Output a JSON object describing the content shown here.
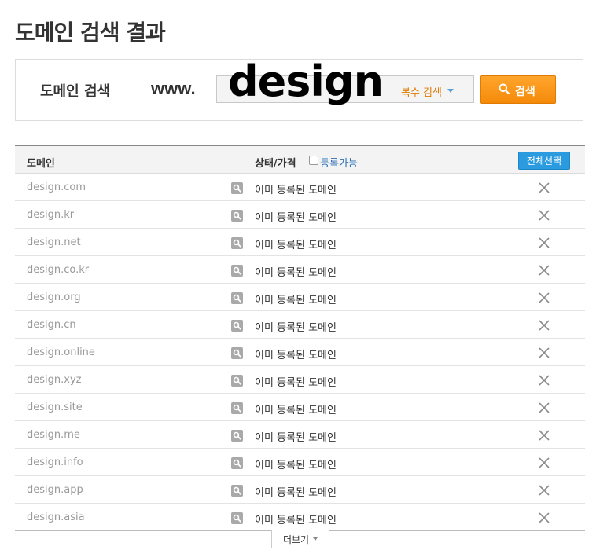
{
  "page": {
    "title": "도메인 검색 결과"
  },
  "search": {
    "label": "도메인 검색",
    "prefix": "www.",
    "value": "design",
    "multi_search_label": "복수 검색",
    "button_label": "검색"
  },
  "table": {
    "header": {
      "domain": "도메인",
      "status": "상태/가격",
      "available_filter": "등록가능",
      "select_all": "전체선택"
    },
    "rows": [
      {
        "domain": "design.com",
        "status": "이미 등록된 도메인"
      },
      {
        "domain": "design.kr",
        "status": "이미 등록된 도메인"
      },
      {
        "domain": "design.net",
        "status": "이미 등록된 도메인"
      },
      {
        "domain": "design.co.kr",
        "status": "이미 등록된 도메인"
      },
      {
        "domain": "design.org",
        "status": "이미 등록된 도메인"
      },
      {
        "domain": "design.cn",
        "status": "이미 등록된 도메인"
      },
      {
        "domain": "design.online",
        "status": "이미 등록된 도메인"
      },
      {
        "domain": "design.xyz",
        "status": "이미 등록된 도메인"
      },
      {
        "domain": "design.site",
        "status": "이미 등록된 도메인"
      },
      {
        "domain": "design.me",
        "status": "이미 등록된 도메인"
      },
      {
        "domain": "design.info",
        "status": "이미 등록된 도메인"
      },
      {
        "domain": "design.app",
        "status": "이미 등록된 도메인"
      },
      {
        "domain": "design.asia",
        "status": "이미 등록된 도메인"
      }
    ],
    "more_label": "더보기"
  },
  "colors": {
    "accent_orange": "#f58a0a",
    "select_blue": "#2b9be0",
    "link_blue": "#2d6fb5"
  },
  "icons": {
    "search_button": "search-icon",
    "row_lookup": "magnifier-icon",
    "row_unavailable": "close-icon",
    "dropdown": "caret-down-icon"
  }
}
